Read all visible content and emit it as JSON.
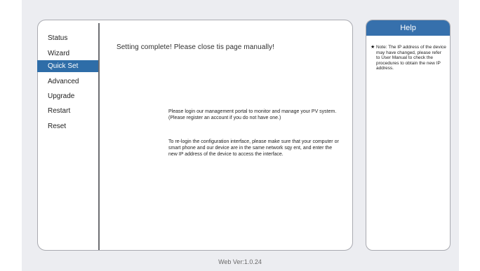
{
  "nav": {
    "items": [
      {
        "label": "Status",
        "active": false
      },
      {
        "label": "Wizard",
        "active": false
      },
      {
        "label": "Quick Set",
        "active": true
      },
      {
        "label": "Advanced",
        "active": false
      },
      {
        "label": "Upgrade",
        "active": false
      },
      {
        "label": "Restart",
        "active": false
      },
      {
        "label": "Reset",
        "active": false
      }
    ]
  },
  "main": {
    "headline": "Setting complete! Please close tis page manually!",
    "paragraph_login": "Please login our management portal to monitor and manage your PV system.(Please register an account if you do not have one.)",
    "paragraph_relogin": "To re-login the configuration interface, please make sure that your computer or smart phone and our device are in the same network sqy ent, and enter the new IP address of the device to access the interface."
  },
  "help": {
    "title": "Help",
    "bullet": "★",
    "note": "Note: The IP address of the device may have changed, please refer to User Manual to check the procedures to obtain the new IP address."
  },
  "footer": {
    "version": "Web Ver:1.0.24"
  },
  "colors": {
    "accent": "#2e6da8",
    "help_header": "#3670ac",
    "background": "#ecedf1"
  }
}
